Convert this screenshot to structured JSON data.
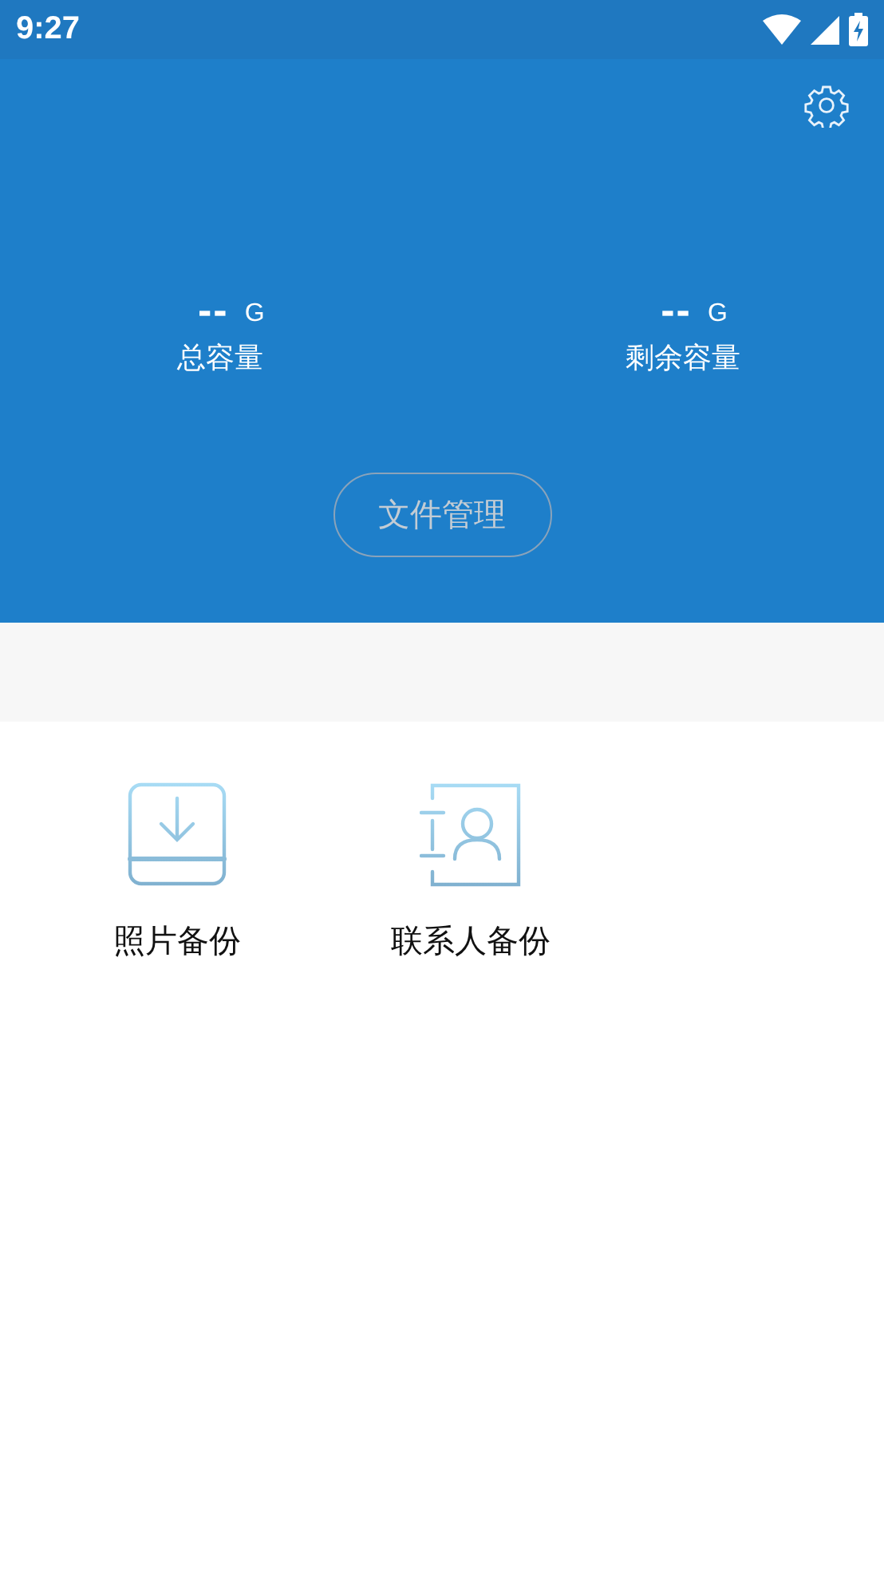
{
  "status_bar": {
    "time": "9:27"
  },
  "storage": [
    {
      "value": "--",
      "unit": "G",
      "label": "总容量"
    },
    {
      "value": "--",
      "unit": "G",
      "label": "剩余容量"
    }
  ],
  "file_button": {
    "label": "文件管理",
    "disabled": true
  },
  "tiles": [
    {
      "kind": "photo",
      "label": "照片备份"
    },
    {
      "kind": "contacts",
      "label": "联系人备份"
    }
  ]
}
